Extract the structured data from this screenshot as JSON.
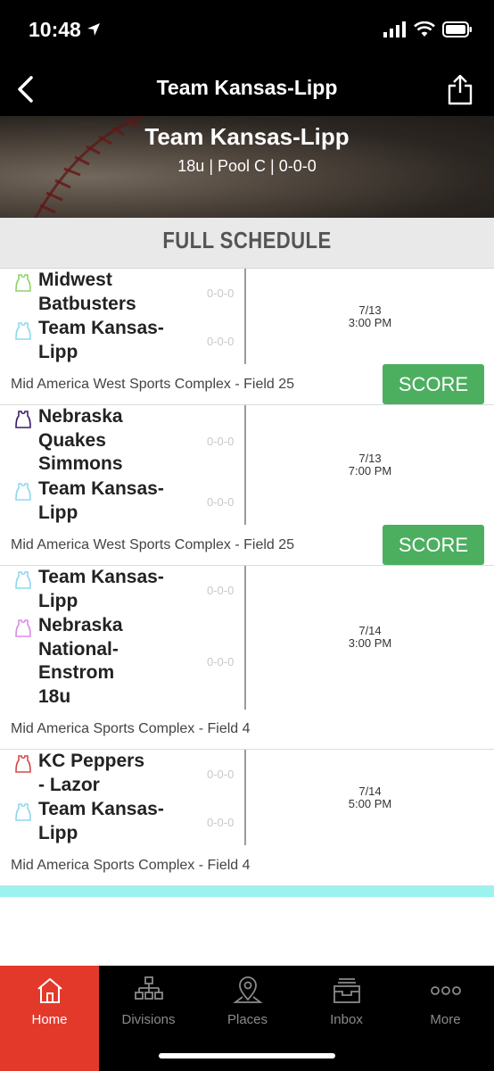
{
  "status_bar": {
    "time": "10:48"
  },
  "nav": {
    "title": "Team Kansas-Lipp"
  },
  "hero": {
    "title": "Team Kansas-Lipp",
    "subtitle": "18u | Pool C | 0-0-0"
  },
  "schedule": {
    "heading": "FULL SCHEDULE",
    "score_label": "SCORE",
    "games": [
      {
        "teams": [
          {
            "name": "Midwest Batbusters",
            "record": "0-0-0",
            "jersey_color": "#8fd46a"
          },
          {
            "name": "Team Kansas-Lipp",
            "record": "0-0-0",
            "jersey_color": "#8fd8ef"
          }
        ],
        "date": "7/13",
        "time": "3:00 PM",
        "venue": "Mid America West Sports Complex - Field 25",
        "has_score_button": true
      },
      {
        "teams": [
          {
            "name": "Nebraska Quakes Simmons",
            "record": "0-0-0",
            "jersey_color": "#3a1f6b"
          },
          {
            "name": "Team Kansas-Lipp",
            "record": "0-0-0",
            "jersey_color": "#8fd8ef"
          }
        ],
        "date": "7/13",
        "time": "7:00 PM",
        "venue": "Mid America West Sports Complex - Field 25",
        "has_score_button": true
      },
      {
        "teams": [
          {
            "name": "Team Kansas-Lipp",
            "record": "0-0-0",
            "jersey_color": "#8fd8ef"
          },
          {
            "name": "Nebraska National-Enstrom 18u",
            "record": "0-0-0",
            "jersey_color": "#d88fe6"
          }
        ],
        "date": "7/14",
        "time": "3:00 PM",
        "venue": "Mid America Sports Complex - Field 4",
        "has_score_button": false
      },
      {
        "teams": [
          {
            "name": "KC Peppers - Lazor",
            "record": "0-0-0",
            "jersey_color": "#d64848"
          },
          {
            "name": "Team Kansas-Lipp",
            "record": "0-0-0",
            "jersey_color": "#8fd8ef"
          }
        ],
        "date": "7/14",
        "time": "5:00 PM",
        "venue": "Mid America Sports Complex - Field 4",
        "has_score_button": false
      }
    ]
  },
  "tabs": [
    {
      "label": "Home",
      "icon": "home-icon",
      "active": true
    },
    {
      "label": "Divisions",
      "icon": "bracket-icon",
      "active": false
    },
    {
      "label": "Places",
      "icon": "map-pin-icon",
      "active": false
    },
    {
      "label": "Inbox",
      "icon": "inbox-icon",
      "active": false
    },
    {
      "label": "More",
      "icon": "more-icon",
      "active": false
    }
  ],
  "colors": {
    "accent": "#e3392b",
    "score_button": "#4caf5f",
    "highlight_strip": "#9af3ee"
  }
}
